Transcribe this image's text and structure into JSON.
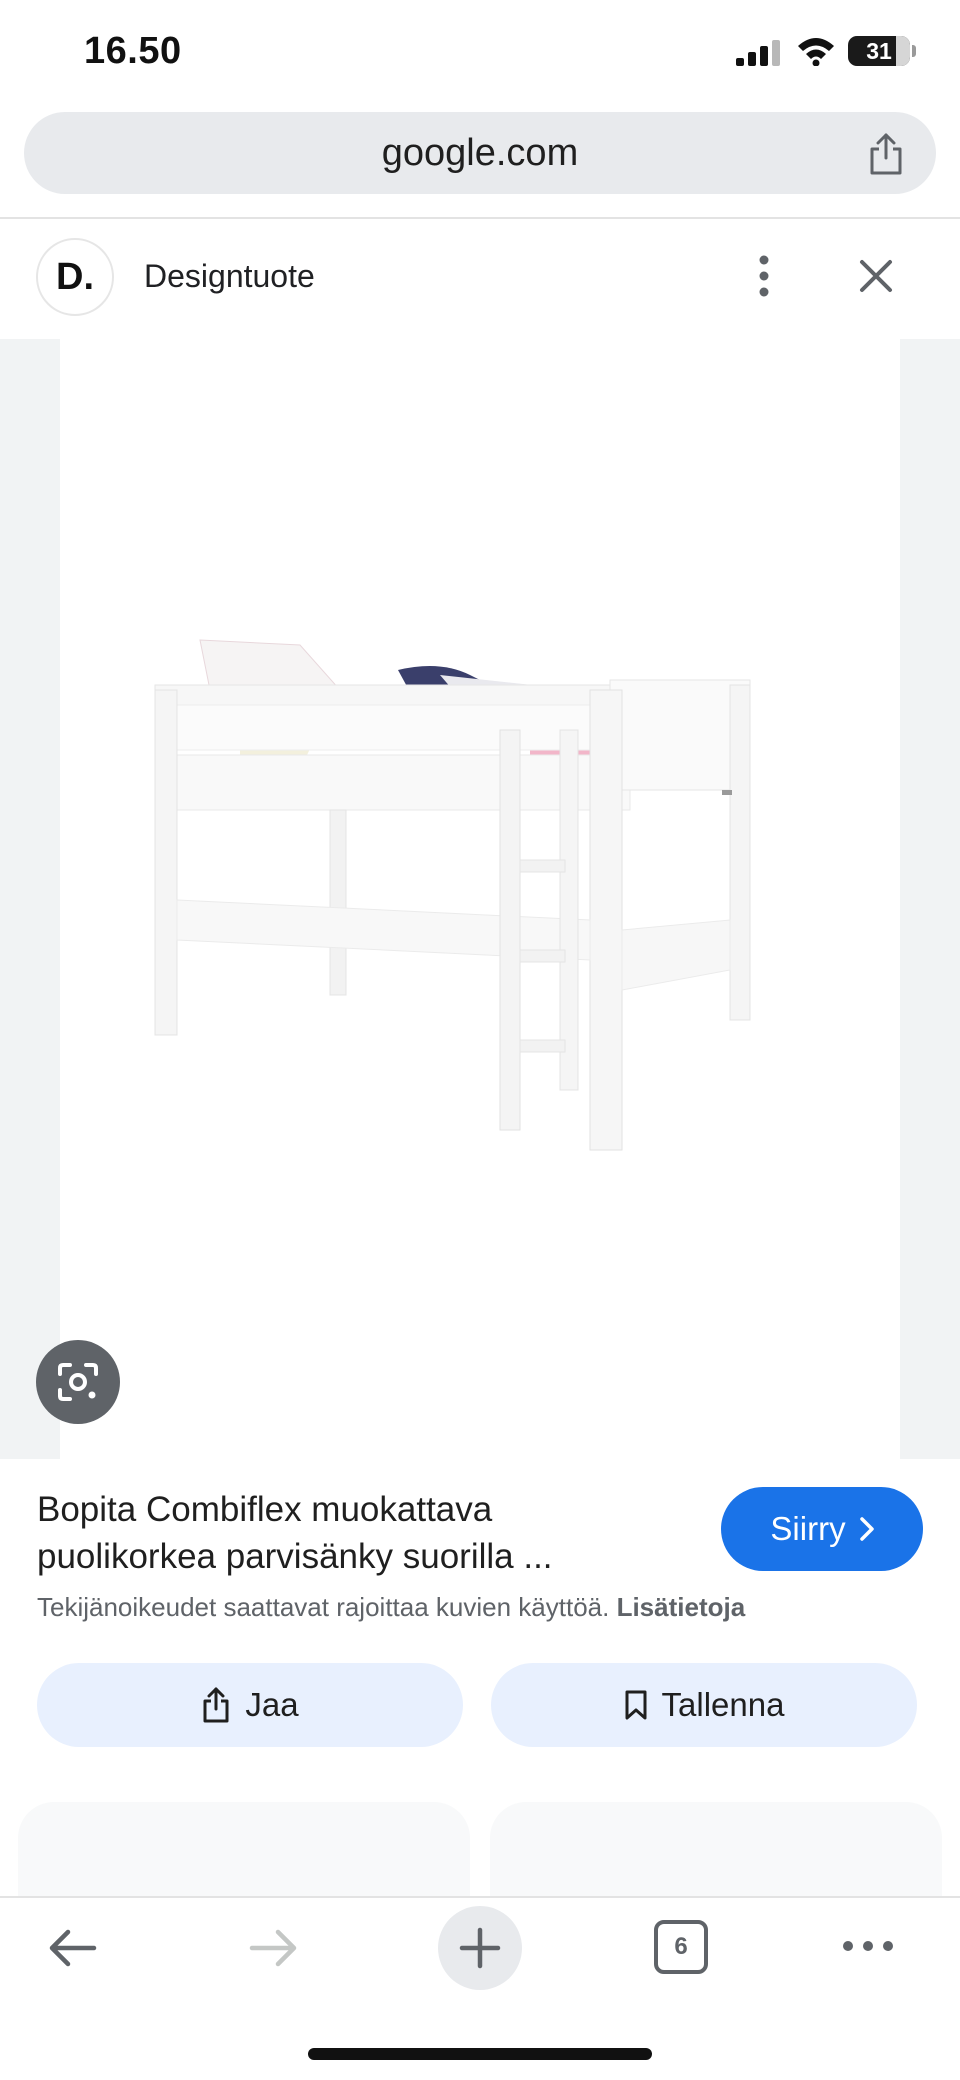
{
  "status_bar": {
    "time": "16.50",
    "battery": "31"
  },
  "browser": {
    "url": "google.com",
    "tabs_count": "6"
  },
  "source": {
    "logo_text": "D.",
    "name": "Designtuote"
  },
  "result": {
    "title": "Bopita Combiflex muokattava puolikorkea parvisänky suorilla ...",
    "visit_label": "Siirry",
    "copyright_text": "Tekijänoikeudet saattavat rajoittaa kuvien käyttöä.",
    "more_info_label": "Lisätietoja",
    "share_label": "Jaa",
    "save_label": "Tallenna"
  },
  "icons": [
    "signal-icon",
    "wifi-icon",
    "share-icon",
    "more-vert-icon",
    "close-icon",
    "lens-icon",
    "chevron-right-icon",
    "bookmark-icon",
    "back-arrow-icon",
    "forward-arrow-icon",
    "plus-icon",
    "more-horiz-icon"
  ],
  "colors": {
    "accent": "#1a73e8",
    "pill_bg": "#e8f0fe",
    "url_bar_bg": "#e8eaed"
  }
}
